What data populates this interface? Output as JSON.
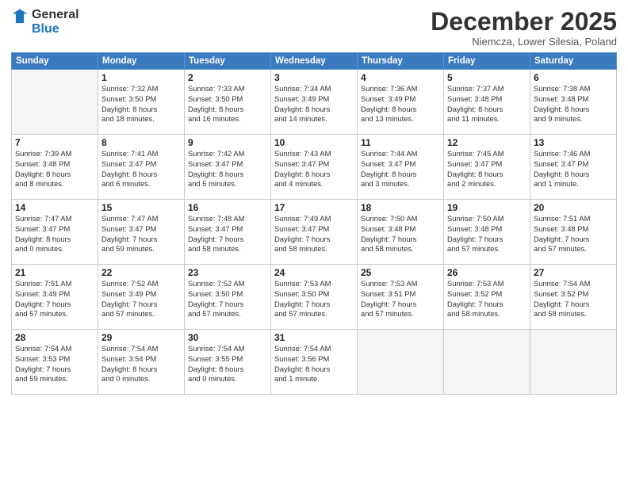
{
  "header": {
    "logo_line1": "General",
    "logo_line2": "Blue",
    "month_title": "December 2025",
    "location": "Niemcza, Lower Silesia, Poland"
  },
  "days_of_week": [
    "Sunday",
    "Monday",
    "Tuesday",
    "Wednesday",
    "Thursday",
    "Friday",
    "Saturday"
  ],
  "weeks": [
    [
      {
        "num": "",
        "sunrise": "",
        "sunset": "",
        "daylight": ""
      },
      {
        "num": "1",
        "sunrise": "Sunrise: 7:32 AM",
        "sunset": "Sunset: 3:50 PM",
        "daylight": "Daylight: 8 hours and 18 minutes."
      },
      {
        "num": "2",
        "sunrise": "Sunrise: 7:33 AM",
        "sunset": "Sunset: 3:50 PM",
        "daylight": "Daylight: 8 hours and 16 minutes."
      },
      {
        "num": "3",
        "sunrise": "Sunrise: 7:34 AM",
        "sunset": "Sunset: 3:49 PM",
        "daylight": "Daylight: 8 hours and 14 minutes."
      },
      {
        "num": "4",
        "sunrise": "Sunrise: 7:36 AM",
        "sunset": "Sunset: 3:49 PM",
        "daylight": "Daylight: 8 hours and 13 minutes."
      },
      {
        "num": "5",
        "sunrise": "Sunrise: 7:37 AM",
        "sunset": "Sunset: 3:48 PM",
        "daylight": "Daylight: 8 hours and 11 minutes."
      },
      {
        "num": "6",
        "sunrise": "Sunrise: 7:38 AM",
        "sunset": "Sunset: 3:48 PM",
        "daylight": "Daylight: 8 hours and 9 minutes."
      }
    ],
    [
      {
        "num": "7",
        "sunrise": "Sunrise: 7:39 AM",
        "sunset": "Sunset: 3:48 PM",
        "daylight": "Daylight: 8 hours and 8 minutes."
      },
      {
        "num": "8",
        "sunrise": "Sunrise: 7:41 AM",
        "sunset": "Sunset: 3:47 PM",
        "daylight": "Daylight: 8 hours and 6 minutes."
      },
      {
        "num": "9",
        "sunrise": "Sunrise: 7:42 AM",
        "sunset": "Sunset: 3:47 PM",
        "daylight": "Daylight: 8 hours and 5 minutes."
      },
      {
        "num": "10",
        "sunrise": "Sunrise: 7:43 AM",
        "sunset": "Sunset: 3:47 PM",
        "daylight": "Daylight: 8 hours and 4 minutes."
      },
      {
        "num": "11",
        "sunrise": "Sunrise: 7:44 AM",
        "sunset": "Sunset: 3:47 PM",
        "daylight": "Daylight: 8 hours and 3 minutes."
      },
      {
        "num": "12",
        "sunrise": "Sunrise: 7:45 AM",
        "sunset": "Sunset: 3:47 PM",
        "daylight": "Daylight: 8 hours and 2 minutes."
      },
      {
        "num": "13",
        "sunrise": "Sunrise: 7:46 AM",
        "sunset": "Sunset: 3:47 PM",
        "daylight": "Daylight: 8 hours and 1 minute."
      }
    ],
    [
      {
        "num": "14",
        "sunrise": "Sunrise: 7:47 AM",
        "sunset": "Sunset: 3:47 PM",
        "daylight": "Daylight: 8 hours and 0 minutes."
      },
      {
        "num": "15",
        "sunrise": "Sunrise: 7:47 AM",
        "sunset": "Sunset: 3:47 PM",
        "daylight": "Daylight: 7 hours and 59 minutes."
      },
      {
        "num": "16",
        "sunrise": "Sunrise: 7:48 AM",
        "sunset": "Sunset: 3:47 PM",
        "daylight": "Daylight: 7 hours and 58 minutes."
      },
      {
        "num": "17",
        "sunrise": "Sunrise: 7:49 AM",
        "sunset": "Sunset: 3:47 PM",
        "daylight": "Daylight: 7 hours and 58 minutes."
      },
      {
        "num": "18",
        "sunrise": "Sunrise: 7:50 AM",
        "sunset": "Sunset: 3:48 PM",
        "daylight": "Daylight: 7 hours and 58 minutes."
      },
      {
        "num": "19",
        "sunrise": "Sunrise: 7:50 AM",
        "sunset": "Sunset: 3:48 PM",
        "daylight": "Daylight: 7 hours and 57 minutes."
      },
      {
        "num": "20",
        "sunrise": "Sunrise: 7:51 AM",
        "sunset": "Sunset: 3:48 PM",
        "daylight": "Daylight: 7 hours and 57 minutes."
      }
    ],
    [
      {
        "num": "21",
        "sunrise": "Sunrise: 7:51 AM",
        "sunset": "Sunset: 3:49 PM",
        "daylight": "Daylight: 7 hours and 57 minutes."
      },
      {
        "num": "22",
        "sunrise": "Sunrise: 7:52 AM",
        "sunset": "Sunset: 3:49 PM",
        "daylight": "Daylight: 7 hours and 57 minutes."
      },
      {
        "num": "23",
        "sunrise": "Sunrise: 7:52 AM",
        "sunset": "Sunset: 3:50 PM",
        "daylight": "Daylight: 7 hours and 57 minutes."
      },
      {
        "num": "24",
        "sunrise": "Sunrise: 7:53 AM",
        "sunset": "Sunset: 3:50 PM",
        "daylight": "Daylight: 7 hours and 57 minutes."
      },
      {
        "num": "25",
        "sunrise": "Sunrise: 7:53 AM",
        "sunset": "Sunset: 3:51 PM",
        "daylight": "Daylight: 7 hours and 57 minutes."
      },
      {
        "num": "26",
        "sunrise": "Sunrise: 7:53 AM",
        "sunset": "Sunset: 3:52 PM",
        "daylight": "Daylight: 7 hours and 58 minutes."
      },
      {
        "num": "27",
        "sunrise": "Sunrise: 7:54 AM",
        "sunset": "Sunset: 3:52 PM",
        "daylight": "Daylight: 7 hours and 58 minutes."
      }
    ],
    [
      {
        "num": "28",
        "sunrise": "Sunrise: 7:54 AM",
        "sunset": "Sunset: 3:53 PM",
        "daylight": "Daylight: 7 hours and 59 minutes."
      },
      {
        "num": "29",
        "sunrise": "Sunrise: 7:54 AM",
        "sunset": "Sunset: 3:54 PM",
        "daylight": "Daylight: 8 hours and 0 minutes."
      },
      {
        "num": "30",
        "sunrise": "Sunrise: 7:54 AM",
        "sunset": "Sunset: 3:55 PM",
        "daylight": "Daylight: 8 hours and 0 minutes."
      },
      {
        "num": "31",
        "sunrise": "Sunrise: 7:54 AM",
        "sunset": "Sunset: 3:56 PM",
        "daylight": "Daylight: 8 hours and 1 minute."
      },
      {
        "num": "",
        "sunrise": "",
        "sunset": "",
        "daylight": ""
      },
      {
        "num": "",
        "sunrise": "",
        "sunset": "",
        "daylight": ""
      },
      {
        "num": "",
        "sunrise": "",
        "sunset": "",
        "daylight": ""
      }
    ]
  ]
}
